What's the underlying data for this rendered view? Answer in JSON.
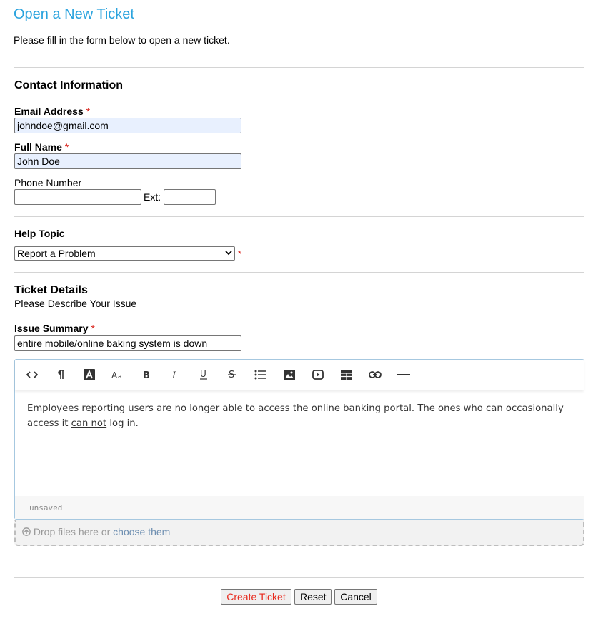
{
  "page": {
    "title": "Open a New Ticket",
    "intro": "Please fill in the form below to open a new ticket."
  },
  "contact": {
    "heading": "Contact Information",
    "email_label": "Email Address",
    "email_value": "johndoe@gmail.com",
    "name_label": "Full Name",
    "name_value": "John Doe",
    "phone_label": "Phone Number",
    "phone_value": "",
    "ext_label": "Ext:",
    "ext_value": "",
    "required_mark": "*"
  },
  "help_topic": {
    "heading": "Help Topic",
    "selected": "Report a Problem",
    "required_mark": "*"
  },
  "details": {
    "heading": "Ticket Details",
    "subheading": "Please Describe Your Issue",
    "summary_label": "Issue Summary",
    "summary_value": "entire mobile/online baking system is down",
    "required_mark": "*"
  },
  "editor": {
    "toolbar": [
      "code-icon",
      "paragraph-icon",
      "font-color-icon",
      "font-size-icon",
      "bold-icon",
      "italic-icon",
      "underline-icon",
      "strikethrough-icon",
      "list-icon",
      "image-icon",
      "video-icon",
      "table-icon",
      "link-icon",
      "horizontal-rule-icon"
    ],
    "text_before": "Employees reporting users are no longer able to access the online banking portal. The ones who can occasionally access it ",
    "text_underlined": "can not",
    "text_after": " log in.",
    "status": "unsaved"
  },
  "dropzone": {
    "text": "Drop files here or",
    "link": "choose them"
  },
  "buttons": {
    "create": "Create Ticket",
    "reset": "Reset",
    "cancel": "Cancel"
  },
  "colors": {
    "title": "#2aa3de",
    "required": "#d9221a",
    "create_button_text": "#e8291c",
    "autofill_bg": "#e8f0fe"
  }
}
